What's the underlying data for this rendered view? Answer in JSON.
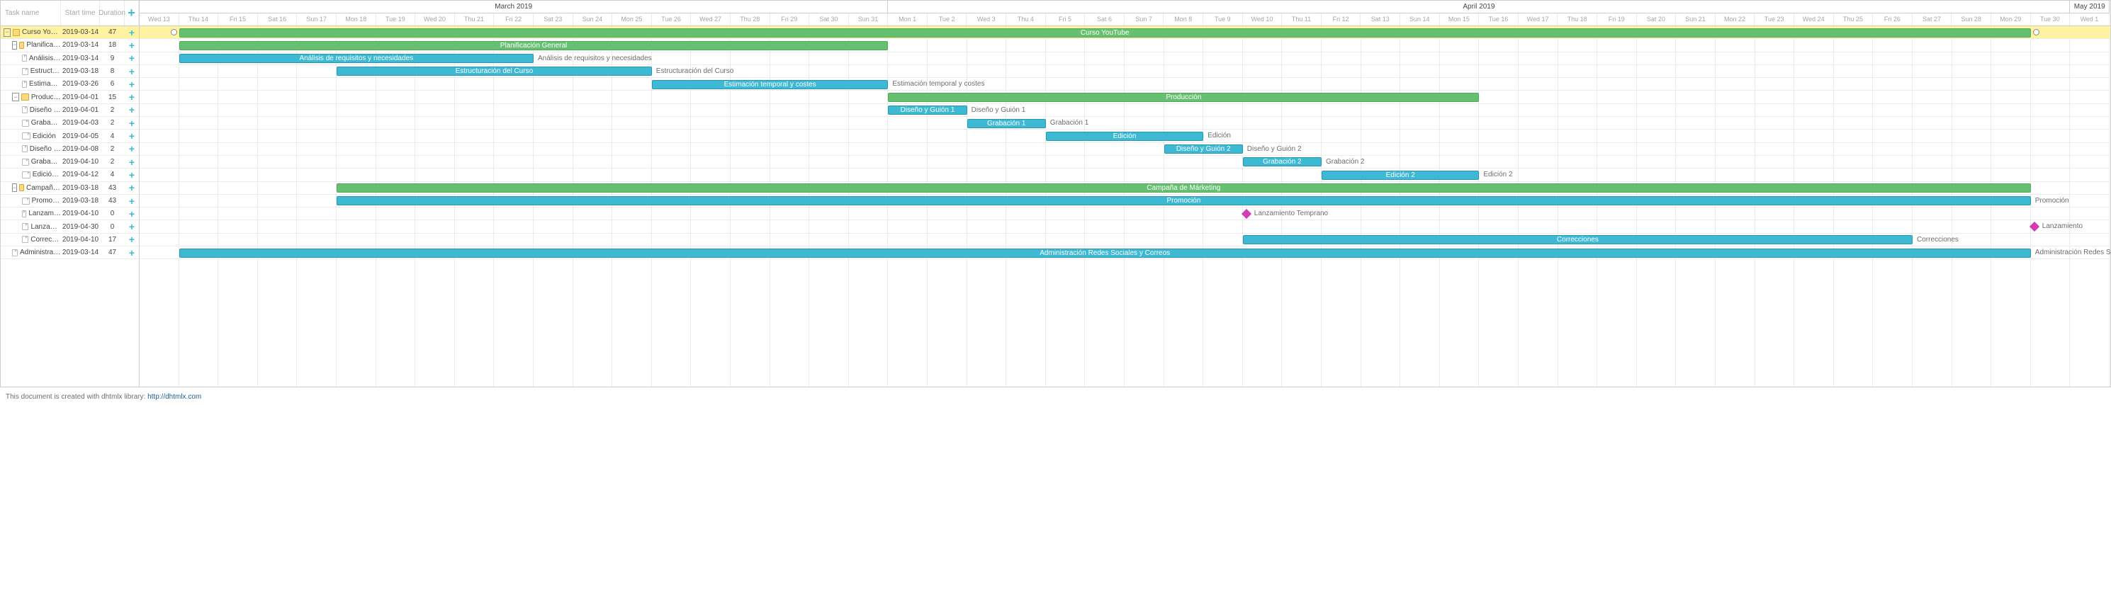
{
  "columns": {
    "name": "Task name",
    "start": "Start time",
    "dur": "Duration"
  },
  "months": [
    {
      "label": "March 2019",
      "span": 19
    },
    {
      "label": "April 2019",
      "span": 30
    },
    {
      "label": "May 2019",
      "span": 1
    }
  ],
  "days": [
    "Wed 13",
    "Thu 14",
    "Fri 15",
    "Sat 16",
    "Sun 17",
    "Mon 18",
    "Tue 19",
    "Wed 20",
    "Thu 21",
    "Fri 22",
    "Sat 23",
    "Sun 24",
    "Mon 25",
    "Tue 26",
    "Wed 27",
    "Thu 28",
    "Fri 29",
    "Sat 30",
    "Sun 31",
    "Mon 1",
    "Tue 2",
    "Wed 3",
    "Thu 4",
    "Fri 5",
    "Sat 6",
    "Sun 7",
    "Mon 8",
    "Tue 9",
    "Wed 10",
    "Thu 11",
    "Fri 12",
    "Sat 13",
    "Sun 14",
    "Mon 15",
    "Tue 16",
    "Wed 17",
    "Thu 18",
    "Fri 19",
    "Sat 20",
    "Sun 21",
    "Mon 22",
    "Tue 23",
    "Wed 24",
    "Thu 25",
    "Fri 26",
    "Sat 27",
    "Sun 28",
    "Mon 29",
    "Tue 30",
    "Wed 1"
  ],
  "tasks": [
    {
      "name": "Curso YouTube",
      "start": "2019-03-14",
      "dur": 47,
      "indent": 0,
      "type": "folder",
      "toggle": true,
      "selected": true,
      "bar": {
        "from": 1,
        "len": 47,
        "cls": "green",
        "text": "Curso YouTube",
        "caps": true
      }
    },
    {
      "name": "Planificación General",
      "start": "2019-03-14",
      "dur": 18,
      "indent": 1,
      "type": "folder",
      "toggle": true,
      "bar": {
        "from": 1,
        "len": 18,
        "cls": "green",
        "text": "Planificación General"
      }
    },
    {
      "name": "Análisis de requisitos",
      "start": "2019-03-14",
      "dur": 9,
      "indent": 2,
      "type": "file",
      "bar": {
        "from": 1,
        "len": 9,
        "cls": "blue",
        "text": "Análisis de requisitos y necesidades",
        "after": "Análisis de requisitos y necesidades"
      }
    },
    {
      "name": "Estructuración",
      "start": "2019-03-18",
      "dur": 8,
      "indent": 2,
      "type": "file",
      "bar": {
        "from": 5,
        "len": 8,
        "cls": "blue",
        "text": "Estructuración del Curso",
        "after": "Estructuración del Curso"
      }
    },
    {
      "name": "Estimación temporal",
      "start": "2019-03-26",
      "dur": 6,
      "indent": 2,
      "type": "file",
      "bar": {
        "from": 13,
        "len": 6,
        "cls": "blue",
        "text": "Estimación temporal y costes",
        "after": "Estimación temporal y costes"
      }
    },
    {
      "name": "Producción",
      "start": "2019-04-01",
      "dur": 15,
      "indent": 1,
      "type": "folder",
      "toggle": true,
      "bar": {
        "from": 19,
        "len": 15,
        "cls": "green",
        "text": "Producción"
      }
    },
    {
      "name": "Diseño y Guión 1",
      "start": "2019-04-01",
      "dur": 2,
      "indent": 2,
      "type": "file",
      "bar": {
        "from": 19,
        "len": 2,
        "cls": "blue",
        "text": "Diseño y Guión 1",
        "after": "Diseño y Guión 1"
      }
    },
    {
      "name": "Grabación 1",
      "start": "2019-04-03",
      "dur": 2,
      "indent": 2,
      "type": "file",
      "bar": {
        "from": 21,
        "len": 2,
        "cls": "blue",
        "text": "Grabación 1",
        "after": "Grabación 1"
      }
    },
    {
      "name": "Edición",
      "start": "2019-04-05",
      "dur": 4,
      "indent": 2,
      "type": "file",
      "bar": {
        "from": 23,
        "len": 4,
        "cls": "blue",
        "text": "Edición",
        "after": "Edición"
      }
    },
    {
      "name": "Diseño y Guión 2",
      "start": "2019-04-08",
      "dur": 2,
      "indent": 2,
      "type": "file",
      "bar": {
        "from": 26,
        "len": 2,
        "cls": "blue",
        "text": "Diseño y Guión 2",
        "after": "Diseño y Guión 2"
      }
    },
    {
      "name": "Grabación 2",
      "start": "2019-04-10",
      "dur": 2,
      "indent": 2,
      "type": "file",
      "bar": {
        "from": 28,
        "len": 2,
        "cls": "blue",
        "text": "Grabación 2",
        "after": "Grabación 2"
      }
    },
    {
      "name": "Edición 2",
      "start": "2019-04-12",
      "dur": 4,
      "indent": 2,
      "type": "file",
      "bar": {
        "from": 30,
        "len": 4,
        "cls": "blue",
        "text": "Edición 2",
        "after": "Edición 2"
      }
    },
    {
      "name": "Campaña de Márketing",
      "start": "2019-03-18",
      "dur": 43,
      "indent": 1,
      "type": "folder",
      "toggle": true,
      "bar": {
        "from": 5,
        "len": 43,
        "cls": "green",
        "text": "Campaña de Márketing"
      }
    },
    {
      "name": "Promoción",
      "start": "2019-03-18",
      "dur": 43,
      "indent": 2,
      "type": "file",
      "bar": {
        "from": 5,
        "len": 43,
        "cls": "blue",
        "text": "Promoción",
        "after": "Promoción"
      }
    },
    {
      "name": "Lanzamiento Temprano",
      "start": "2019-04-10",
      "dur": 0,
      "indent": 2,
      "type": "file",
      "ms": {
        "at": 28,
        "label": "Lanzamiento Temprano"
      }
    },
    {
      "name": "Lanzamiento",
      "start": "2019-04-30",
      "dur": 0,
      "indent": 2,
      "type": "file",
      "ms": {
        "at": 48,
        "label": "Lanzamiento"
      }
    },
    {
      "name": "Correcciones",
      "start": "2019-04-10",
      "dur": 17,
      "indent": 2,
      "type": "file",
      "bar": {
        "from": 28,
        "len": 17,
        "cls": "blue",
        "text": "Correcciones",
        "after": "Correcciones"
      }
    },
    {
      "name": "Administración Redes",
      "start": "2019-03-14",
      "dur": 47,
      "indent": 1,
      "type": "file",
      "bar": {
        "from": 1,
        "len": 47,
        "cls": "blue",
        "text": "Administración Redes Sociales y Correos",
        "after": "Administración Redes Sociales y Correos"
      }
    }
  ],
  "footer": {
    "text": "This document is created with dhtmlx library: ",
    "link": "http://dhtmlx.com"
  },
  "chart_data": {
    "type": "gantt",
    "title": "Curso YouTube",
    "date_range": [
      "2019-03-13",
      "2019-05-01"
    ],
    "tasks": [
      {
        "id": 1,
        "name": "Curso YouTube",
        "start": "2019-03-14",
        "duration": 47,
        "type": "project"
      },
      {
        "id": 2,
        "parent": 1,
        "name": "Planificación General",
        "start": "2019-03-14",
        "duration": 18,
        "type": "project"
      },
      {
        "id": 3,
        "parent": 2,
        "name": "Análisis de requisitos y necesidades",
        "start": "2019-03-14",
        "duration": 9,
        "type": "task"
      },
      {
        "id": 4,
        "parent": 2,
        "name": "Estructuración del Curso",
        "start": "2019-03-18",
        "duration": 8,
        "type": "task"
      },
      {
        "id": 5,
        "parent": 2,
        "name": "Estimación temporal y costes",
        "start": "2019-03-26",
        "duration": 6,
        "type": "task"
      },
      {
        "id": 6,
        "parent": 1,
        "name": "Producción",
        "start": "2019-04-01",
        "duration": 15,
        "type": "project"
      },
      {
        "id": 7,
        "parent": 6,
        "name": "Diseño y Guión 1",
        "start": "2019-04-01",
        "duration": 2,
        "type": "task"
      },
      {
        "id": 8,
        "parent": 6,
        "name": "Grabación 1",
        "start": "2019-04-03",
        "duration": 2,
        "type": "task"
      },
      {
        "id": 9,
        "parent": 6,
        "name": "Edición",
        "start": "2019-04-05",
        "duration": 4,
        "type": "task"
      },
      {
        "id": 10,
        "parent": 6,
        "name": "Diseño y Guión 2",
        "start": "2019-04-08",
        "duration": 2,
        "type": "task"
      },
      {
        "id": 11,
        "parent": 6,
        "name": "Grabación 2",
        "start": "2019-04-10",
        "duration": 2,
        "type": "task"
      },
      {
        "id": 12,
        "parent": 6,
        "name": "Edición 2",
        "start": "2019-04-12",
        "duration": 4,
        "type": "task"
      },
      {
        "id": 13,
        "parent": 1,
        "name": "Campaña de Márketing",
        "start": "2019-03-18",
        "duration": 43,
        "type": "project"
      },
      {
        "id": 14,
        "parent": 13,
        "name": "Promoción",
        "start": "2019-03-18",
        "duration": 43,
        "type": "task"
      },
      {
        "id": 15,
        "parent": 13,
        "name": "Lanzamiento Temprano",
        "start": "2019-04-10",
        "duration": 0,
        "type": "milestone"
      },
      {
        "id": 16,
        "parent": 13,
        "name": "Lanzamiento",
        "start": "2019-04-30",
        "duration": 0,
        "type": "milestone"
      },
      {
        "id": 17,
        "parent": 13,
        "name": "Correcciones",
        "start": "2019-04-10",
        "duration": 17,
        "type": "task"
      },
      {
        "id": 18,
        "parent": 1,
        "name": "Administración Redes Sociales y Correos",
        "start": "2019-03-14",
        "duration": 47,
        "type": "task"
      }
    ]
  }
}
